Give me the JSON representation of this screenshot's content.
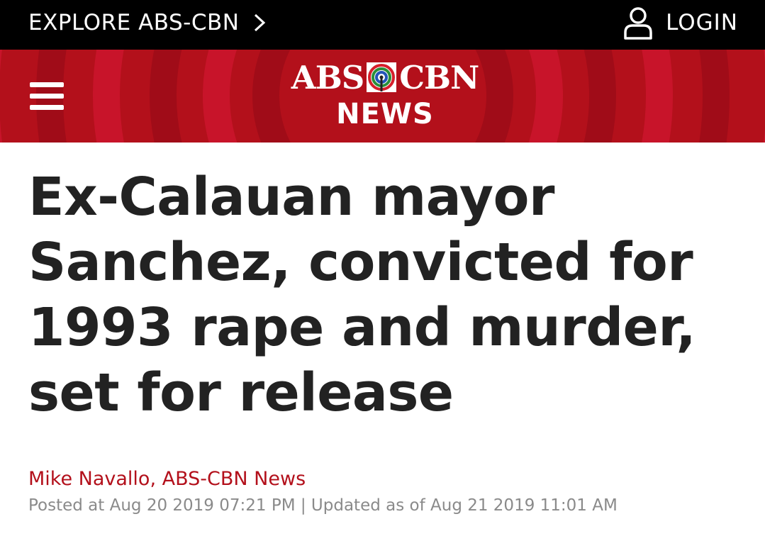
{
  "topbar": {
    "explore_label": "EXPLORE ABS-CBN",
    "explore_icon": "chevron-right-icon",
    "login_label": "LOGIN",
    "login_icon": "user-icon"
  },
  "header": {
    "menu_icon": "hamburger-menu-icon",
    "logo_left": "ABS",
    "logo_right": "CBN",
    "logo_sub": "NEWS",
    "brand_color": "#b3101b"
  },
  "article": {
    "headline": "Ex-Calauan mayor Sanchez, convicted for 1993 rape and murder, set for release",
    "byline": "Mike Navallo, ABS-CBN News",
    "timestamps": "Posted at Aug 20 2019 07:21 PM | Updated as of Aug 21 2019 11:01 AM"
  }
}
